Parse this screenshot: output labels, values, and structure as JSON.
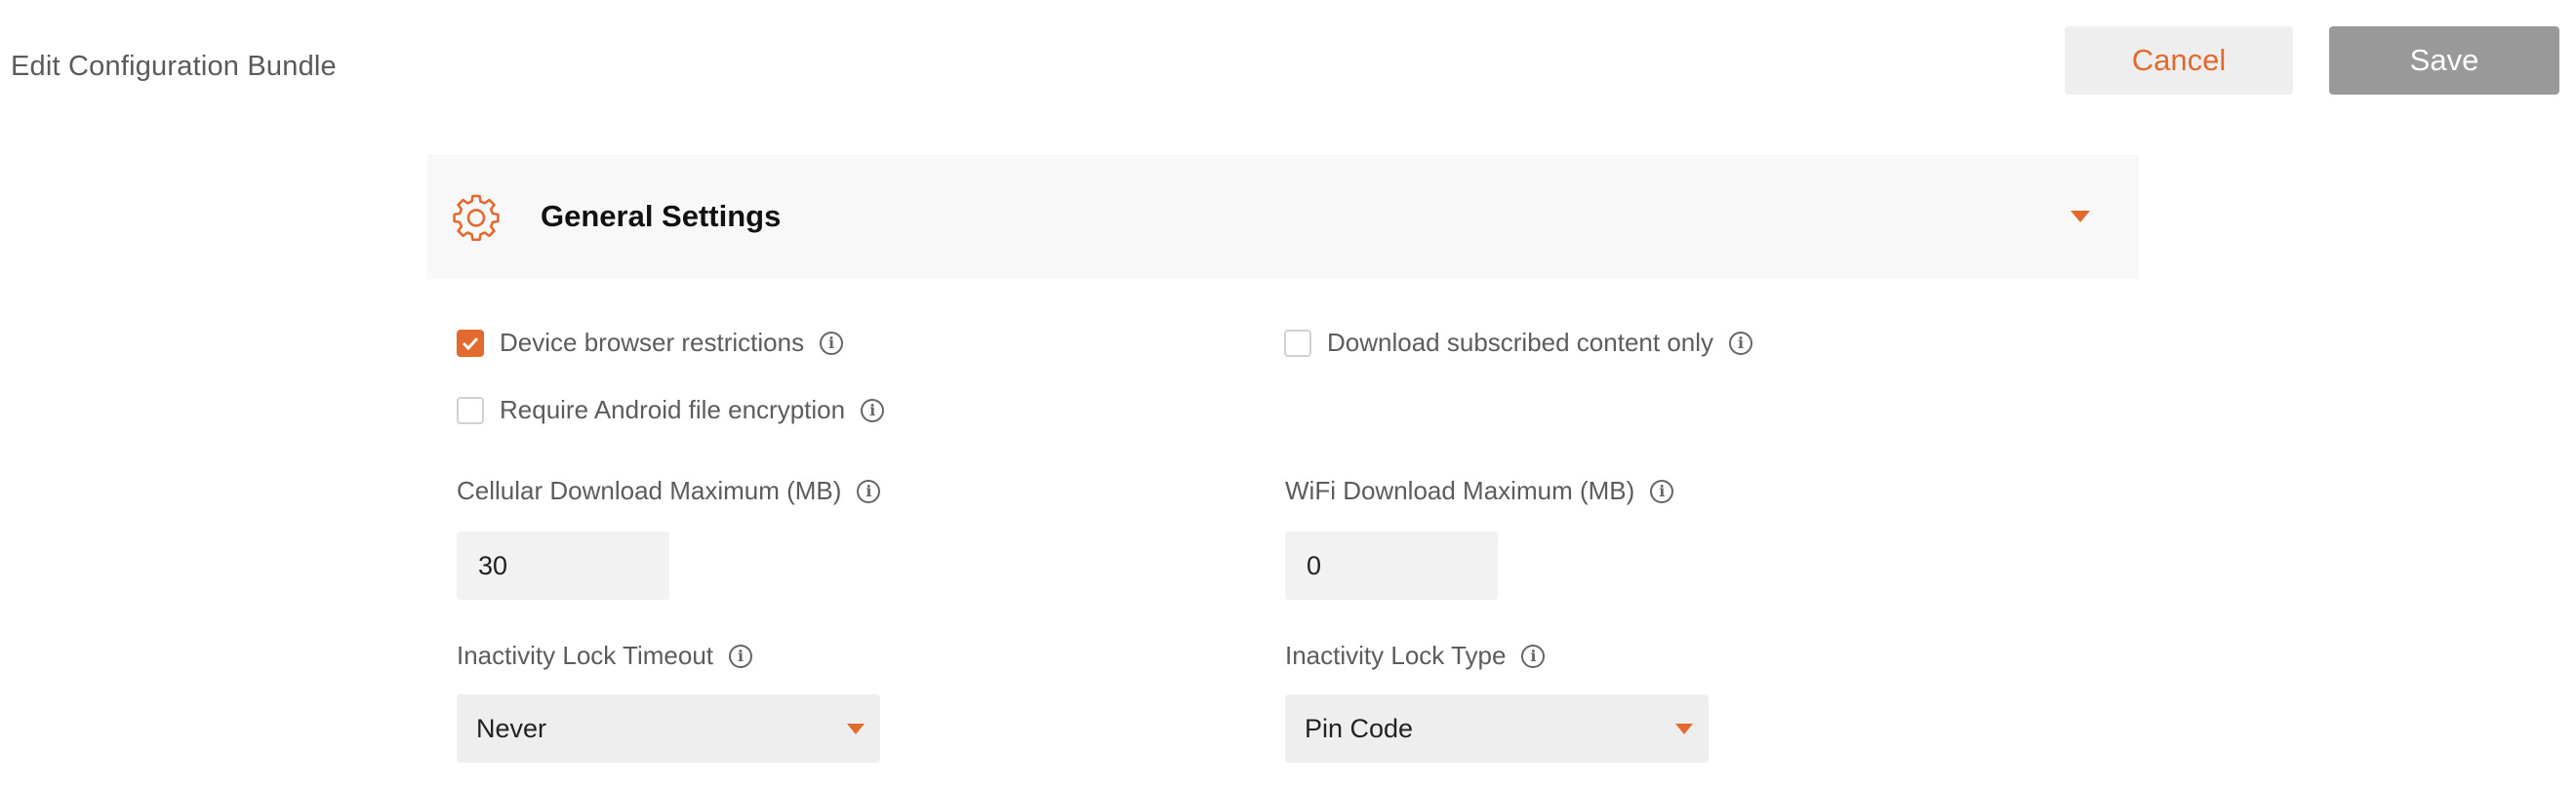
{
  "header": {
    "title": "Edit Configuration Bundle",
    "cancel_label": "Cancel",
    "save_label": "Save"
  },
  "panel": {
    "title": "General Settings",
    "icon": "gear-icon",
    "expanded": true
  },
  "options": {
    "device_browser_restrictions": {
      "label": "Device browser restrictions",
      "checked": true
    },
    "download_subscribed_only": {
      "label": "Download subscribed content only",
      "checked": false
    },
    "require_android_encryption": {
      "label": "Require Android file encryption",
      "checked": false
    }
  },
  "fields": {
    "cellular_max": {
      "label": "Cellular Download Maximum (MB)",
      "value": "30"
    },
    "wifi_max": {
      "label": "WiFi Download Maximum (MB)",
      "value": "0"
    },
    "inactivity_timeout": {
      "label": "Inactivity Lock Timeout",
      "value": "Never"
    },
    "inactivity_type": {
      "label": "Inactivity Lock Type",
      "value": "Pin Code"
    }
  },
  "colors": {
    "accent": "#e36a2e",
    "save_button": "#999999",
    "cancel_button": "#eeeeee"
  }
}
